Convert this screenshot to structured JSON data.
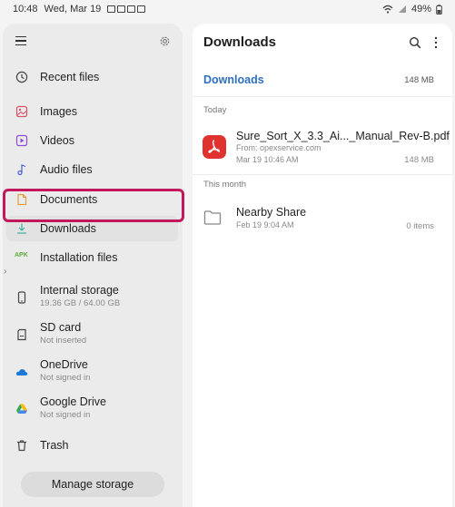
{
  "status_bar": {
    "time": "10:48",
    "date": "Wed, Mar 19",
    "battery": "49%"
  },
  "sidebar": {
    "items": [
      {
        "label": "Recent files",
        "icon": "clock-icon"
      },
      {
        "label": "Images",
        "icon": "image-icon",
        "color": "#d9546a"
      },
      {
        "label": "Videos",
        "icon": "video-icon",
        "color": "#8e4dd6"
      },
      {
        "label": "Audio files",
        "icon": "music-note-icon",
        "color": "#4a5fd6"
      },
      {
        "label": "Documents",
        "icon": "document-icon",
        "color": "#e0a23a"
      },
      {
        "label": "Downloads",
        "icon": "download-icon",
        "color": "#3fae9a"
      },
      {
        "label": "Installation files",
        "icon": "apk-icon",
        "apk_text": "APK",
        "color": "#5fae3a"
      }
    ],
    "storage": [
      {
        "label": "Internal storage",
        "sub": "19.36 GB / 64.00 GB",
        "icon": "phone-icon"
      },
      {
        "label": "SD card",
        "sub": "Not inserted",
        "icon": "sd-card-icon"
      },
      {
        "label": "OneDrive",
        "sub": "Not signed in",
        "icon": "onedrive-icon"
      },
      {
        "label": "Google Drive",
        "sub": "Not signed in",
        "icon": "google-drive-icon"
      }
    ],
    "trash_label": "Trash",
    "manage_storage_label": "Manage storage"
  },
  "main": {
    "title": "Downloads",
    "breadcrumb": "Downloads",
    "breadcrumb_size": "148 MB",
    "sections": [
      {
        "label": "Today",
        "file": {
          "name": "Sure_Sort_X_3.3_Ai..._Manual_Rev-B.pdf",
          "from": "From: opexservice.com",
          "date": "Mar 19 10:46 AM",
          "size": "148 MB",
          "icon": "pdf-icon",
          "color": "#e0322e"
        }
      },
      {
        "label": "This month",
        "file": {
          "name": "Nearby Share",
          "date": "Feb 19 9:04 AM",
          "size": "0 items",
          "icon": "folder-icon"
        }
      }
    ]
  }
}
